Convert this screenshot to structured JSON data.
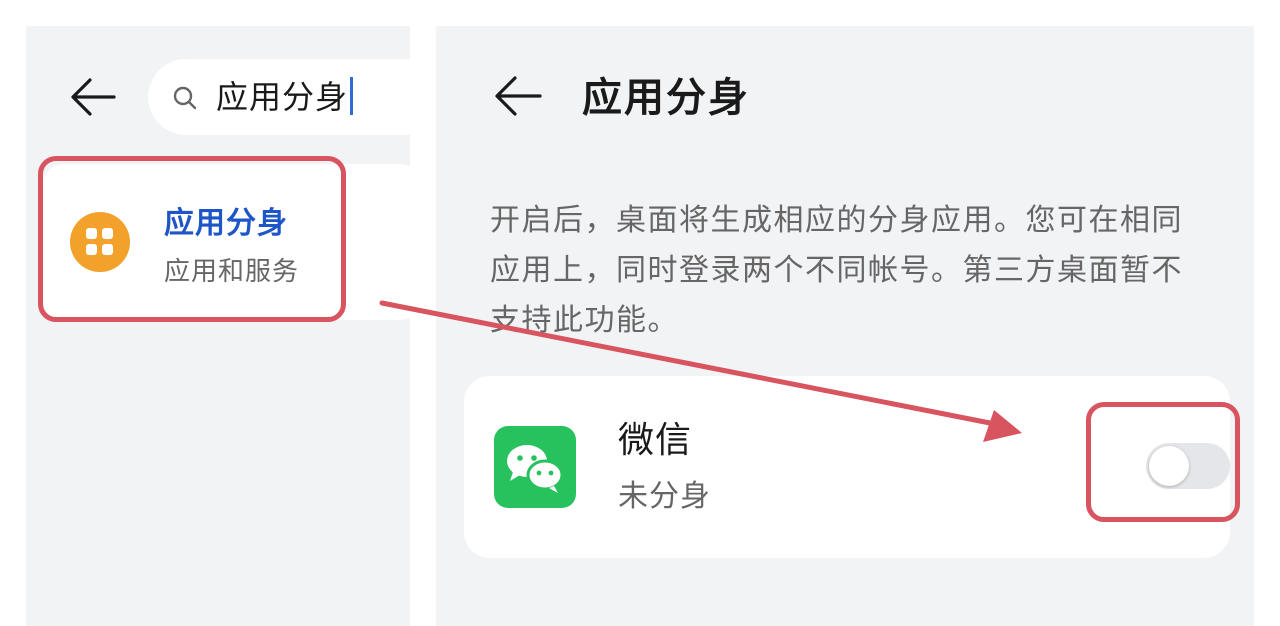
{
  "search_screen": {
    "query": "应用分身",
    "result": {
      "title": "应用分身",
      "subtitle": "应用和服务",
      "icon": "apps-grid-icon"
    }
  },
  "detail_screen": {
    "title": "应用分身",
    "description": "开启后，桌面将生成相应的分身应用。您可在相同应用上，同时登录两个不同帐号。第三方桌面暂不支持此功能。",
    "app": {
      "name": "微信",
      "status": "未分身",
      "icon": "wechat-icon",
      "toggle_on": false
    }
  },
  "colors": {
    "accent_blue": "#1e56c8",
    "highlight_red": "#d8545f",
    "wechat_green": "#27c25e",
    "app_icon_orange": "#f2a12b"
  }
}
